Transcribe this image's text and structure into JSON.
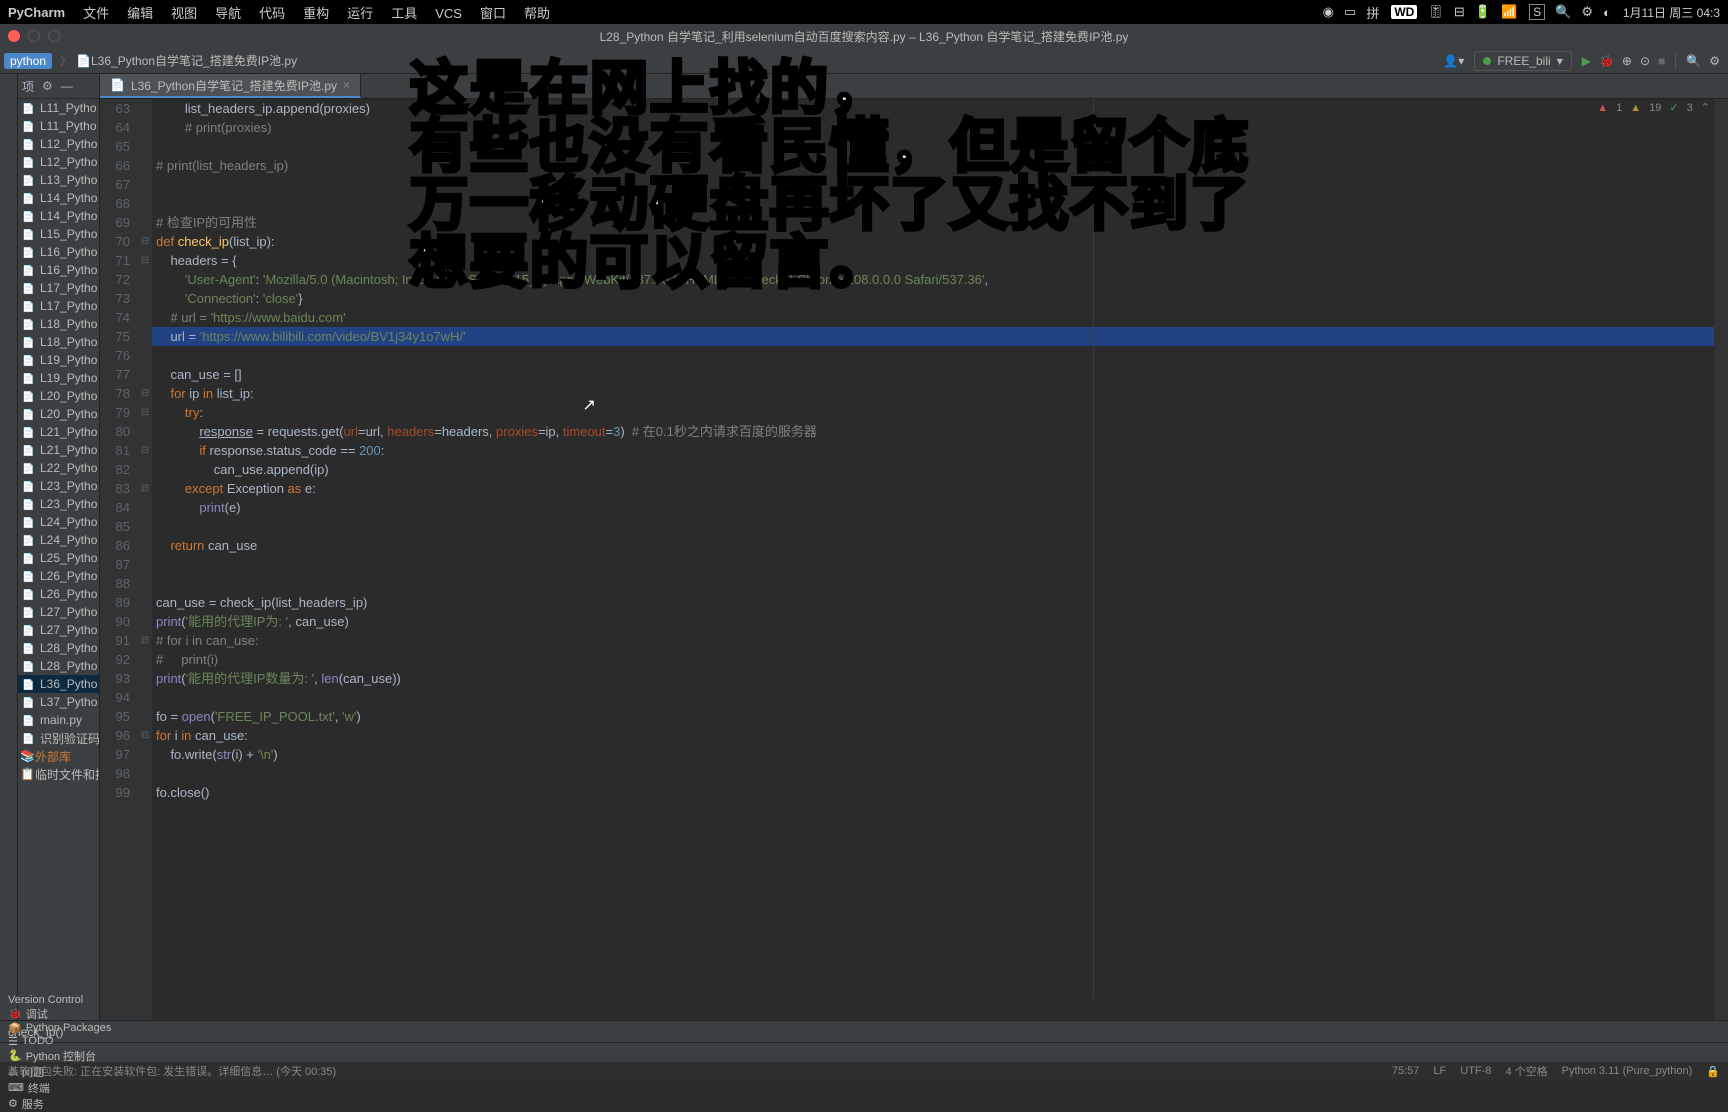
{
  "menubar": {
    "app": "PyCharm",
    "items": [
      "文件",
      "编辑",
      "视图",
      "导航",
      "代码",
      "重构",
      "运行",
      "工具",
      "VCS",
      "窗口",
      "帮助"
    ],
    "status": {
      "wd": "WD",
      "s": "S",
      "date": "1月11日 周三 04:3"
    }
  },
  "titlebar": {
    "title": "L28_Python 自学笔记_利用selenium自动百度搜索内容.py – L36_Python 自学笔记_搭建免费IP池.py"
  },
  "navbar": {
    "crumb1": "python",
    "crumb2": "L36_Python自学笔记_搭建免费IP池.py",
    "run_config": "FREE_bili"
  },
  "tree": {
    "items": [
      "L11_Pytho",
      "L11_Pytho",
      "L12_Pytho",
      "L12_Pytho",
      "L13_Pytho",
      "L14_Pytho",
      "L14_Pytho",
      "L15_Pytho",
      "L16_Pytho",
      "L16_Pytho",
      "L17_Pytho",
      "L17_Pytho",
      "L18_Pytho",
      "L18_Pytho",
      "L19_Pytho",
      "L19_Pytho",
      "L20_Pytho",
      "L20_Pytho",
      "L21_Pytho",
      "L21_Pytho",
      "L22_Pytho",
      "L23_Pytho",
      "L23_Pytho",
      "L24_Pytho",
      "L24_Pytho",
      "L25_Pytho",
      "L26_Pytho",
      "L26_Pytho",
      "L27_Pytho",
      "L27_Pytho",
      "L28_Pytho",
      "L28_Pytho",
      "L36_Pytho",
      "L37_Pytho",
      "main.py",
      "识别验证码"
    ],
    "selected_index": 32,
    "external_lib": "外部库",
    "scratch": "临时文件和控"
  },
  "tab": {
    "name": "L36_Python自学笔记_搭建免费IP池.py"
  },
  "inspection": {
    "err": "1",
    "warn": "19",
    "weak": "3"
  },
  "lines": [
    {
      "n": 63,
      "c": "        list_headers_ip.append(proxies)"
    },
    {
      "n": 64,
      "c": "        # print(proxies)",
      "cls": "cmt"
    },
    {
      "n": 65,
      "c": ""
    },
    {
      "n": 66,
      "c": "# print(list_headers_ip)",
      "cls": "cmt"
    },
    {
      "n": 67,
      "c": ""
    },
    {
      "n": 68,
      "c": ""
    },
    {
      "n": 69,
      "c": "# 检查IP的可用性",
      "cls": "cmt"
    },
    {
      "n": 70,
      "c": "def check_ip(list_ip):",
      "html": "<span class='kw'>def </span><span class='fn'>check_ip</span>(list_ip):"
    },
    {
      "n": 71,
      "c": "    headers = {",
      "html": "    headers = {"
    },
    {
      "n": 72,
      "c": "        'User-Agent': 'Mozilla/5.0 (Macintosh; Intel Mac OS X 10_15_7) AppleWebKit/537.36 (KHTML, like Gecko) Chrome/108.0.0.0 Safari/537.36',",
      "html": "        <span class='str'>'User-Agent'</span>: <span class='str'>'Mozilla/5.0 (Macintosh; Intel Mac OS X 10_15_7) AppleWebKit/537.36 (KHTML, like Gecko) Chrome/108.0.0.0 Safari/537.36'</span>,"
    },
    {
      "n": 73,
      "c": "        'Connection': 'close'}",
      "html": "        <span class='str'>'Connection'</span>: <span class='str'>'close'</span>}"
    },
    {
      "n": 74,
      "c": "    # url = 'https://www.baidu.com'",
      "html": "    <span class='cmt'># url = </span><span class='str'>'https://www.baidu.com'</span>"
    },
    {
      "n": 75,
      "c": "    url = 'https://www.bilibili.com/video/BV1j34y1o7wH/'",
      "html": "    url = <span class='str'>'https://www.bilibili.com/video/BV1j34y1o7wH/'</span>",
      "current": true
    },
    {
      "n": 76,
      "c": ""
    },
    {
      "n": 77,
      "c": "    can_use = []"
    },
    {
      "n": 78,
      "c": "    for ip in list_ip:",
      "html": "    <span class='kw'>for </span>ip <span class='kw'>in </span>list_ip:"
    },
    {
      "n": 79,
      "c": "        try:",
      "html": "        <span class='kw'>try</span>:"
    },
    {
      "n": 80,
      "c": "            response = requests.get(url=url, headers=headers, proxies=ip, timeout=3)  # 在0.1秒之内请求百度的服务器",
      "html": "            <u>response</u> = requests.get(<span class='param'>url</span>=url, <span class='param'>headers</span>=headers, <span class='param'>proxies</span>=ip, <span class='param'>timeout</span>=<span class='num'>3</span>)  <span class='cmt'># 在0.1秒之内请求百度的服务器</span>"
    },
    {
      "n": 81,
      "c": "            if response.status_code == 200:",
      "html": "            <span class='kw'>if </span>response.status_code == <span class='num'>200</span>:"
    },
    {
      "n": 82,
      "c": "                can_use.append(ip)"
    },
    {
      "n": 83,
      "c": "        except Exception as e:",
      "html": "        <span class='kw'>except </span>Exception <span class='kw'>as </span>e:"
    },
    {
      "n": 84,
      "c": "            print(e)",
      "html": "            <span class='builtin'>print</span>(e)"
    },
    {
      "n": 85,
      "c": ""
    },
    {
      "n": 86,
      "c": "    return can_use",
      "html": "    <span class='kw'>return </span>can_use"
    },
    {
      "n": 87,
      "c": ""
    },
    {
      "n": 88,
      "c": ""
    },
    {
      "n": 89,
      "c": "can_use = check_ip(list_headers_ip)"
    },
    {
      "n": 90,
      "c": "print('能用的代理IP为: ', can_use)",
      "html": "<span class='builtin'>print</span>(<span class='str'>'能用的代理IP为: '</span>, can_use)"
    },
    {
      "n": 91,
      "c": "# for i in can_use:",
      "cls": "cmt"
    },
    {
      "n": 92,
      "c": "#     print(i)",
      "cls": "cmt"
    },
    {
      "n": 93,
      "c": "print('能用的代理IP数量为: ', len(can_use))",
      "html": "<span class='builtin'>print</span>(<span class='str'>'能用的代理IP数量为: '</span>, <span class='builtin'>len</span>(can_use))"
    },
    {
      "n": 94,
      "c": ""
    },
    {
      "n": 95,
      "c": "fo = open('FREE_IP_POOL.txt', 'w')",
      "html": "fo = <span class='builtin'>open</span>(<span class='str'>'FREE_IP_POOL.txt'</span>, <span class='str'>'w'</span>)"
    },
    {
      "n": 96,
      "c": "for i in can_use:",
      "html": "<span class='kw'>for </span>i <span class='kw'>in </span>can_use:"
    },
    {
      "n": 97,
      "c": "    fo.write(str(i) + '\\n')",
      "html": "    fo.write(<span class='builtin'>str</span>(i) + <span class='str'>'\\n'</span>)"
    },
    {
      "n": 98,
      "c": ""
    },
    {
      "n": 99,
      "c": "fo.close()"
    }
  ],
  "breadcrumb": {
    "path": "check_ip()"
  },
  "tool_windows": [
    "Version Control",
    "调试",
    "Python Packages",
    "TODO",
    "Python 控制台",
    "问题",
    "终端",
    "服务"
  ],
  "statusbar": {
    "msg": "装软件包失败: 正在安装软件包: 发生错误。详细信息… (今天 00:35)",
    "pos": "75:57",
    "le": "LF",
    "enc": "UTF-8",
    "indent": "4 个空格",
    "sdk": "Python 3.11 (Pure_python)"
  },
  "overlay": {
    "l1": "这是在网上找的，",
    "l2": "有些也没有看民懂，但是留个底",
    "l3": "万一移动硬盘再坏了又找不到了",
    "l4": "想要的可以留言。"
  }
}
